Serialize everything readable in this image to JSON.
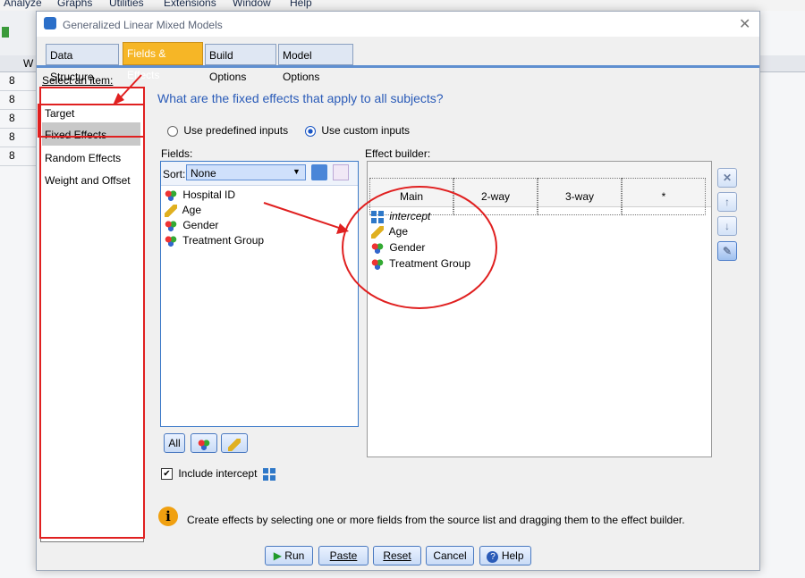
{
  "app_menu": [
    "Analyze",
    "Graphs",
    "Utilities",
    "Extensions",
    "Window",
    "Help"
  ],
  "bg_column_label": "W",
  "bg_rows": [
    "8",
    "8",
    "8",
    "8",
    "8"
  ],
  "dialog": {
    "title": "Generalized Linear Mixed Models",
    "close_label": "✕",
    "tabs": [
      {
        "label": "Data Structure",
        "active": false
      },
      {
        "label": "Fields & Effects",
        "active": true
      },
      {
        "label": "Build Options",
        "active": false
      },
      {
        "label": "Model Options",
        "active": false
      }
    ],
    "select_item_label": "Select an item:",
    "items": [
      "Target",
      "Fixed Effects",
      "Random Effects",
      "Weight and Offset"
    ],
    "question": "What are the fixed effects that apply to all subjects?",
    "radio_predefined": "Use predefined inputs",
    "radio_custom": "Use custom inputs",
    "fields_label": "Fields:",
    "sort_label": "Sort:",
    "sort_value": "None",
    "fields": [
      "Hospital ID",
      "Age",
      "Gender",
      "Treatment Group"
    ],
    "field_types": [
      "nominal",
      "scale",
      "nominal",
      "nominal"
    ],
    "all_button": "All",
    "effect_builder_label": "Effect builder:",
    "effect_columns": [
      "Main",
      "2-way",
      "3-way",
      "*"
    ],
    "effects": [
      "intercept",
      "Age",
      "Gender",
      "Treatment Group"
    ],
    "include_intercept_label": "Include intercept",
    "info_text": "Create effects by selecting one or more fields from the source list and dragging them to the effect builder.",
    "buttons": {
      "run": "Run",
      "paste": "Paste",
      "reset": "Reset",
      "cancel": "Cancel",
      "help": "Help"
    }
  },
  "colors": {
    "active_tab": "#f6b626",
    "accent": "#5f8fd0",
    "question": "#2a5bb8",
    "annotation": "#e02020"
  }
}
